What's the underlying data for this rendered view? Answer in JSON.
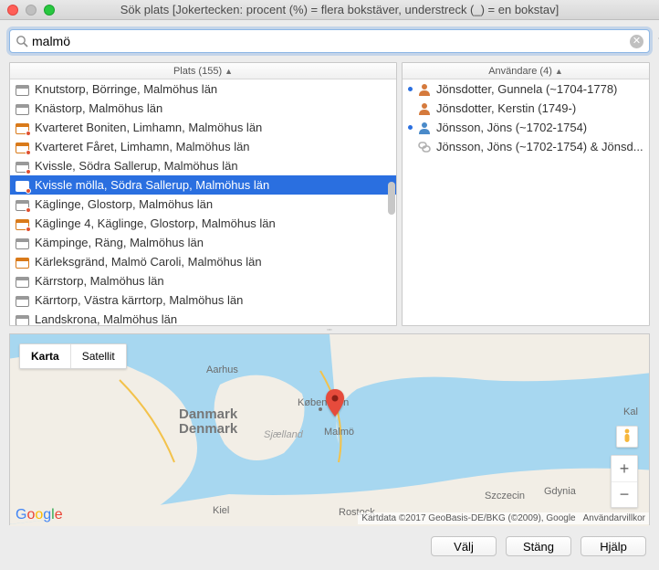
{
  "window": {
    "title": "Sök plats  [Jokertecken: procent (%) = flera bokstäver, understreck (_) = en bokstav]"
  },
  "search": {
    "value": "malmö"
  },
  "left_panel": {
    "header_label": "Plats",
    "header_count": "(155)",
    "items": [
      {
        "icon": "plain",
        "dot": false,
        "label": "Knutstorp, Börringe, Malmöhus län"
      },
      {
        "icon": "plain",
        "dot": false,
        "label": "Knästorp, Malmöhus län"
      },
      {
        "icon": "orange",
        "dot": true,
        "label": "Kvarteret Boniten, Limhamn, Malmöhus län"
      },
      {
        "icon": "orange",
        "dot": true,
        "label": "Kvarteret Fåret, Limhamn, Malmöhus län"
      },
      {
        "icon": "plain",
        "dot": true,
        "label": "Kvissle, Södra Sallerup, Malmöhus län"
      },
      {
        "icon": "plain",
        "dot": true,
        "label": "Kvissle mölla, Södra Sallerup, Malmöhus län",
        "selected": true
      },
      {
        "icon": "plain",
        "dot": true,
        "label": "Käglinge, Glostorp, Malmöhus län"
      },
      {
        "icon": "orange",
        "dot": true,
        "label": "Käglinge 4, Käglinge, Glostorp, Malmöhus län"
      },
      {
        "icon": "plain",
        "dot": false,
        "label": "Kämpinge, Räng, Malmöhus län"
      },
      {
        "icon": "orange",
        "dot": false,
        "label": "Kärleksgränd, Malmö Caroli, Malmöhus län"
      },
      {
        "icon": "plain",
        "dot": false,
        "label": "Kärrstorp, Malmöhus län"
      },
      {
        "icon": "plain",
        "dot": false,
        "label": "Kärrtorp, Västra kärrtorp, Malmöhus län"
      },
      {
        "icon": "plain",
        "dot": false,
        "label": "Landskrona, Malmöhus län"
      }
    ]
  },
  "right_panel": {
    "header_label": "Användare",
    "header_count": "(4)",
    "items": [
      {
        "bullet": true,
        "icon": "person",
        "color": "#d57a3c",
        "label": "Jönsdotter, Gunnela (~1704-1778)"
      },
      {
        "bullet": false,
        "icon": "person",
        "color": "#d57a3c",
        "label": "Jönsdotter, Kerstin (1749-)"
      },
      {
        "bullet": true,
        "icon": "person",
        "color": "#4a8ac9",
        "label": "Jönsson, Jöns (~1702-1754)"
      },
      {
        "bullet": false,
        "icon": "chain",
        "color": "#b0b0b0",
        "label": "Jönsson, Jöns (~1702-1754) & Jönsd..."
      }
    ]
  },
  "map": {
    "type_tabs": {
      "map": "Karta",
      "satellite": "Satellit"
    },
    "labels": {
      "danmark": "Danmark",
      "denmark": "Denmark",
      "kobenhavn": "København",
      "malmo": "Malmö",
      "sjaelland": "Sjælland",
      "aarhus": "Aarhus",
      "kiel": "Kiel",
      "rostock": "Rostock",
      "szczecin": "Szczecin",
      "gdynia": "Gdynia",
      "kal": "Kal"
    },
    "attribution": "Kartdata ©2017 GeoBasis-DE/BKG (©2009), Google",
    "terms": "Användarvillkor"
  },
  "footer": {
    "select": "Välj",
    "close": "Stäng",
    "help": "Hjälp"
  }
}
